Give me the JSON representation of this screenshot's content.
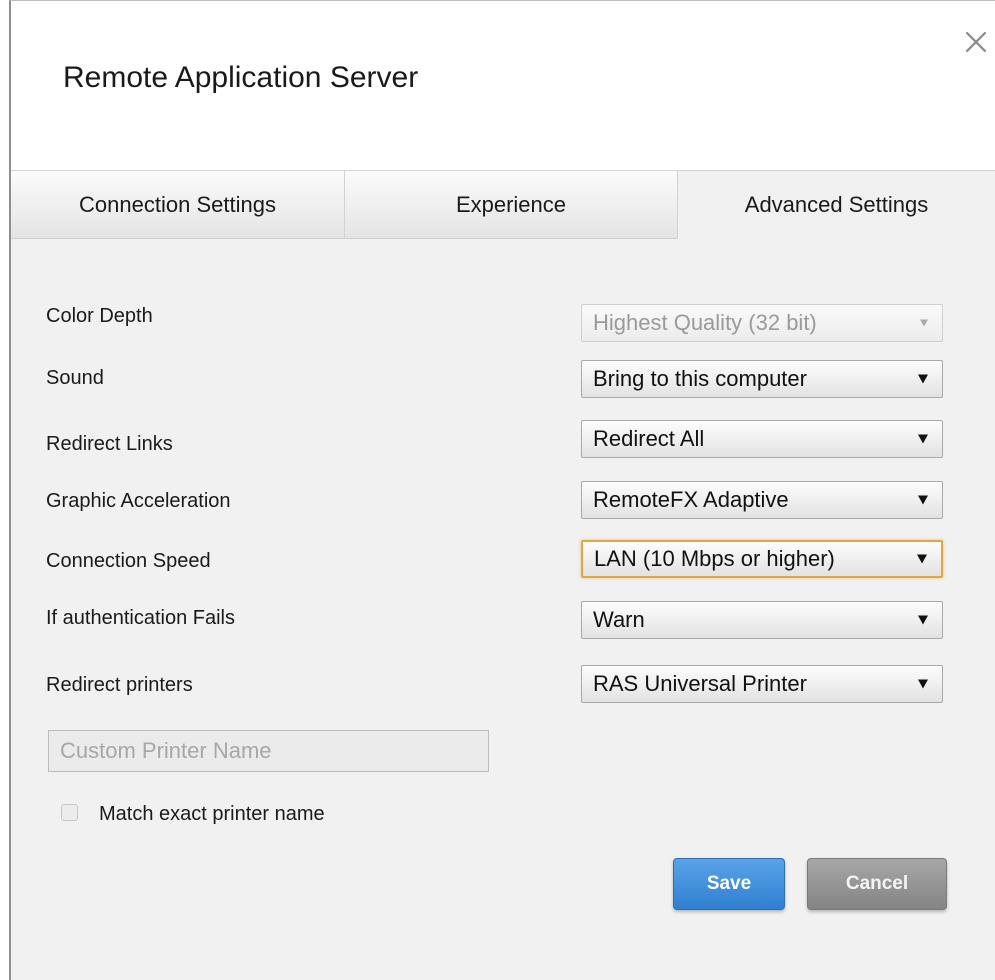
{
  "dialog": {
    "title": "Remote Application Server"
  },
  "tabs": [
    {
      "label": "Connection Settings",
      "active": false
    },
    {
      "label": "Experience",
      "active": false
    },
    {
      "label": "Advanced Settings",
      "active": true
    }
  ],
  "settings": [
    {
      "label": "Color Depth",
      "value": "Highest Quality (32 bit)",
      "state": "disabled"
    },
    {
      "label": "Sound",
      "value": "Bring to this computer",
      "state": "normal"
    },
    {
      "label": "Redirect Links",
      "value": "Redirect All",
      "state": "normal"
    },
    {
      "label": "Graphic Acceleration",
      "value": "RemoteFX Adaptive",
      "state": "normal"
    },
    {
      "label": "Connection Speed",
      "value": "LAN (10 Mbps or higher)",
      "state": "focused"
    },
    {
      "label": "If authentication Fails",
      "value": "Warn",
      "state": "normal"
    },
    {
      "label": "Redirect printers",
      "value": "RAS Universal Printer",
      "state": "normal"
    }
  ],
  "custom_printer": {
    "placeholder": "Custom Printer Name",
    "value": ""
  },
  "match_exact": {
    "label": "Match exact printer name",
    "checked": false
  },
  "buttons": {
    "save": "Save",
    "cancel": "Cancel"
  },
  "colors": {
    "save_button": "#3a8ee0",
    "cancel_button": "#969696",
    "focus_border": "#e0a742",
    "background": "#f1f1f1"
  },
  "icons": {
    "close": "close-icon",
    "dropdown": "dropdown-arrow-icon"
  }
}
